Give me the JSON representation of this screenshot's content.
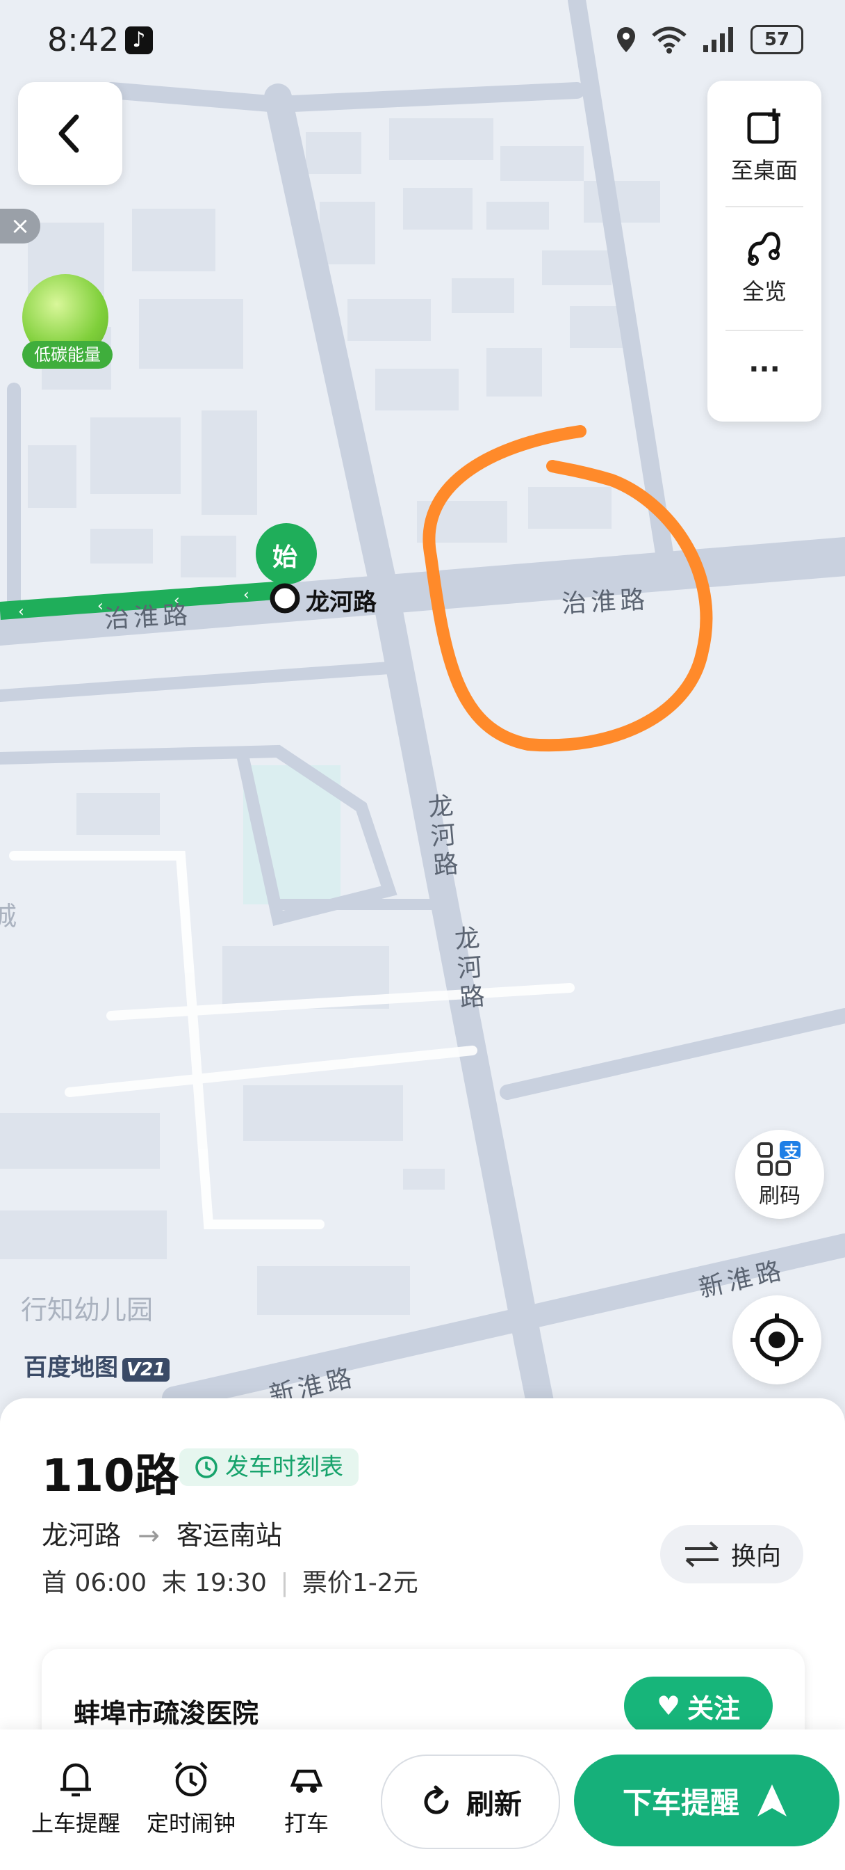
{
  "status_bar": {
    "time": "8:42",
    "battery": "57"
  },
  "map": {
    "road_labels": {
      "zhihuai_left": "治淮路",
      "zhihuai_right": "治淮路",
      "longhe_1": "龙河路",
      "longhe_2": "龙河路",
      "xinhuai_right": "新淮路",
      "xinhuai_bottom": "新淮路"
    },
    "poi_kindergarten": "行知幼儿园",
    "poi_edge": "城",
    "start_badge": "始",
    "start_stop": "龙河路",
    "watermark": "百度地图",
    "watermark_version": "V21",
    "route_color": "#1fae5a",
    "annotation_color": "#ff8a2a"
  },
  "right_panel": {
    "desktop_label": "至桌面",
    "overview_label": "全览",
    "more_label": "···"
  },
  "eco": {
    "label": "低碳能量"
  },
  "pay": {
    "label": "刷码",
    "badge": "支"
  },
  "route": {
    "number": "110路",
    "schedule_label": "发车时刻表",
    "from": "龙河路",
    "arrow": "→",
    "to": "客运南站",
    "first_label": "首 06:00",
    "last_label": "末 19:30",
    "fare": "票价1-2元",
    "switch_label": "换向"
  },
  "hospital": {
    "name": "蚌埠市疏浚医院",
    "follow_label": "关注"
  },
  "toolbar": {
    "board_reminder": "上车提醒",
    "timer_alarm": "定时闹钟",
    "taxi": "打车",
    "refresh": "刷新",
    "alight_reminder": "下车提醒"
  },
  "colors": {
    "accent": "#16b07a",
    "schedule_green": "#17a36c"
  }
}
